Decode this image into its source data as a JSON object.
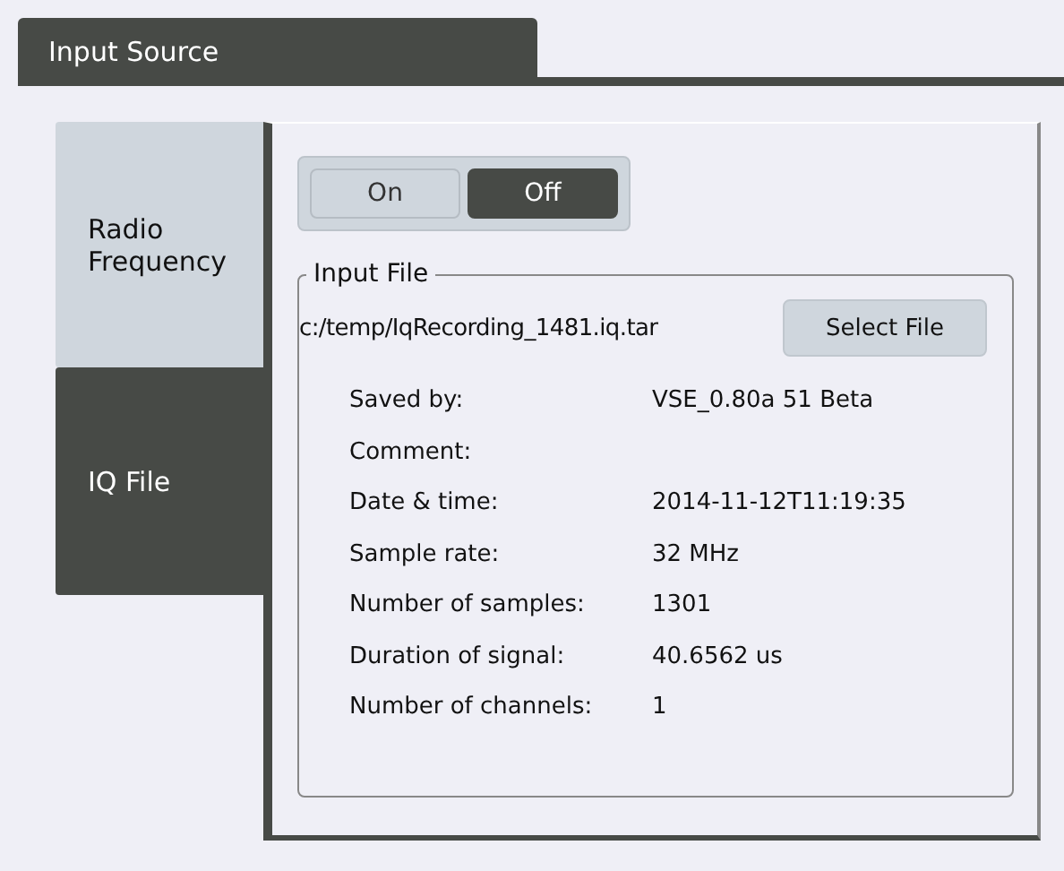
{
  "header": {
    "title": "Input Source"
  },
  "side_tabs": [
    {
      "label": "Radio Frequency",
      "selected": false
    },
    {
      "label": "IQ File",
      "selected": true
    }
  ],
  "toggle": [
    {
      "label": "On",
      "selected": false
    },
    {
      "label": "Off",
      "selected": true
    }
  ],
  "input_file": {
    "legend": "Input File",
    "path": "c:/temp/IqRecording_1481.iq.tar",
    "button": "Select File",
    "info": [
      {
        "label": "Saved by:",
        "value": "VSE_0.80a 51 Beta"
      },
      {
        "label": "Comment:"
      },
      {
        "label": "Date & time:",
        "value": "2014-11-12T11:19:35"
      },
      {
        "label": "Sample rate:",
        "value": "32 MHz"
      },
      {
        "label": "Number of samples:",
        "value": "1301"
      },
      {
        "label": "Duration of signal:",
        "value": "40.6562 us"
      },
      {
        "label": "Number of channels:",
        "value": "1"
      }
    ]
  }
}
